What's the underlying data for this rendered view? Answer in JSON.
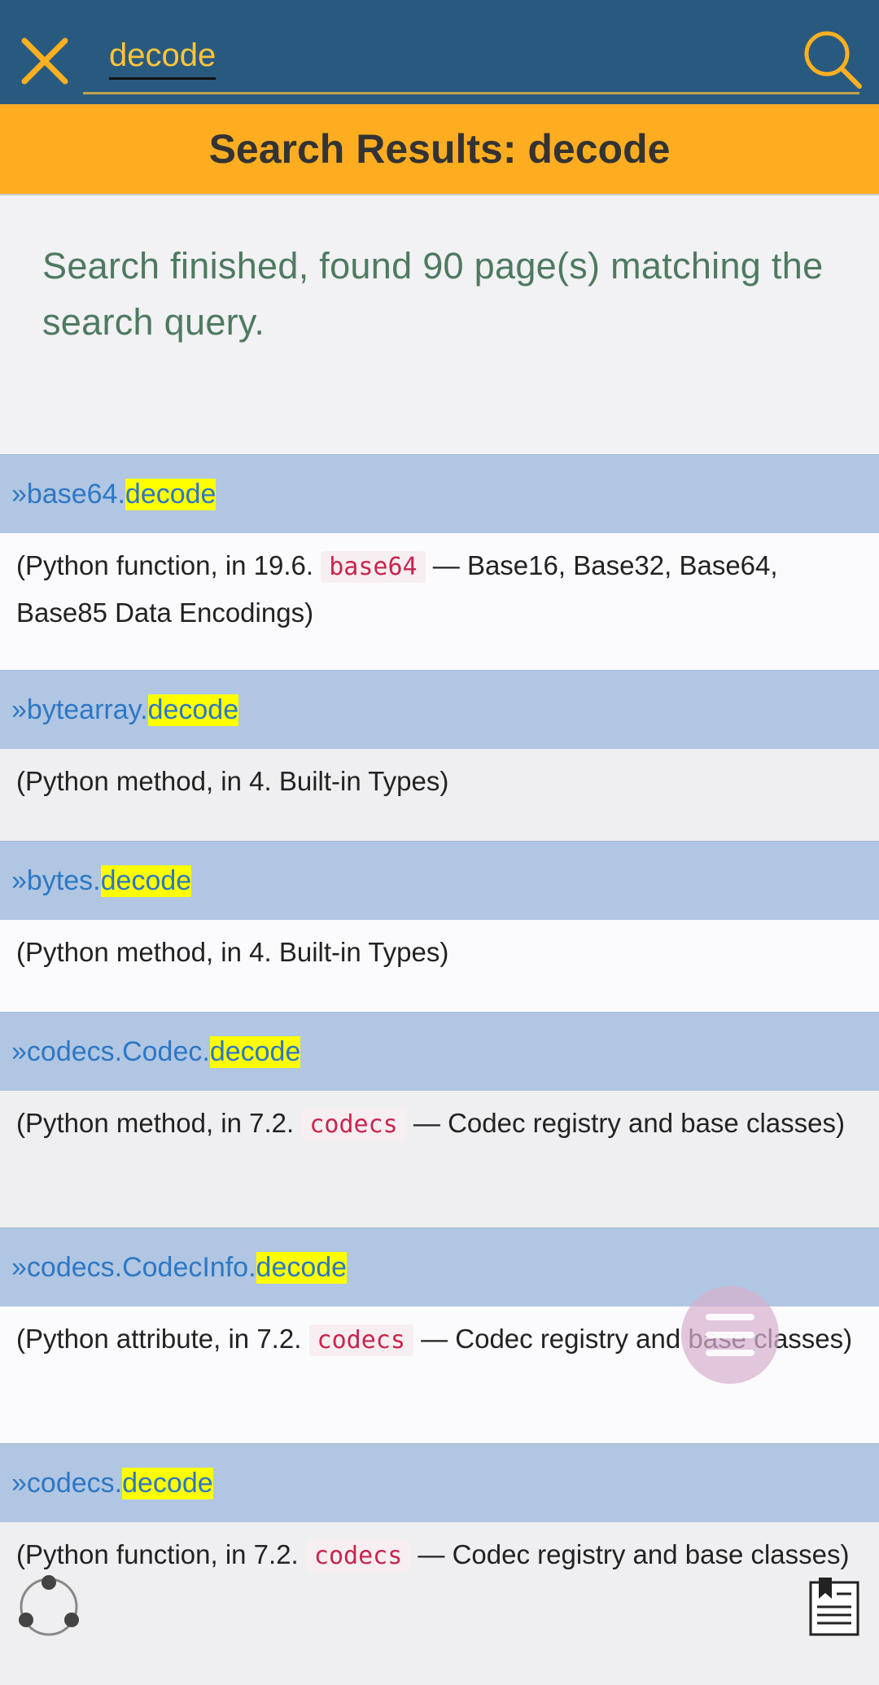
{
  "header": {
    "search_value": "decode",
    "close_icon": "close-icon",
    "search_icon": "search-icon",
    "accent_color": "#ffb020",
    "bar_color": "#285a80"
  },
  "banner": {
    "title": "Search Results: decode"
  },
  "summary": {
    "text": "Search finished, found 90 page(s) matching the search query."
  },
  "results": [
    {
      "prefix": "» ",
      "object": "base64.",
      "match": "decode",
      "desc_before": "(Python function, in 19.6. ",
      "module": "base64",
      "desc_after": " — Base16, Base32, Base64, Base85 Data Encodings)"
    },
    {
      "prefix": "» ",
      "object": "bytearray.",
      "match": "decode",
      "desc": "(Python method, in 4. Built-in Types)"
    },
    {
      "prefix": "» ",
      "object": "bytes.",
      "match": "decode",
      "desc": "(Python method, in 4. Built-in Types)"
    },
    {
      "prefix": "» ",
      "object": "codecs.Codec.",
      "match": "decode",
      "desc_before": "(Python method, in 7.2. ",
      "module": "codecs",
      "desc_after": " — Codec registry and base classes)"
    },
    {
      "prefix": "» ",
      "object": "codecs.CodecInfo.",
      "match": "decode",
      "desc_before": "(Python attribute, in 7.2. ",
      "module": "codecs",
      "desc_after": " — Codec registry and base classes)"
    },
    {
      "prefix": "» ",
      "object": "codecs.",
      "match": "decode",
      "desc_before": "(Python function, in 7.2. ",
      "module": "codecs",
      "desc_after": " — Codec registry and base classes)"
    }
  ],
  "floating": {
    "menu_icon": "hamburger-menu-icon",
    "share_icon": "share-icon",
    "bookmark_icon": "bookmark-icon"
  }
}
